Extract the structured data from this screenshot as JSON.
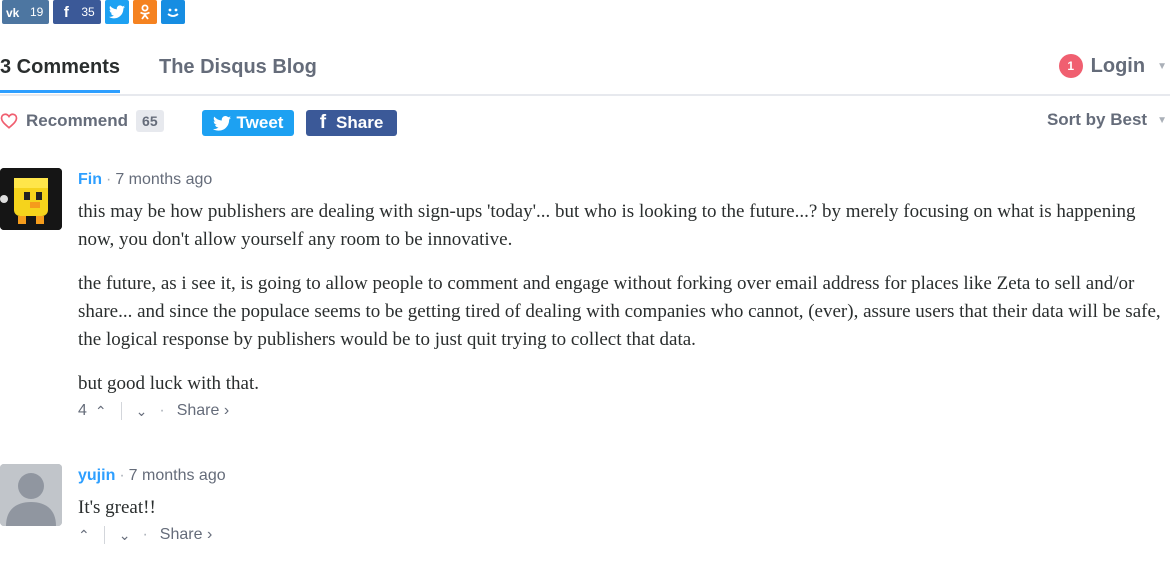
{
  "share_bar": {
    "vk": {
      "icon": "vk-icon",
      "count": "19"
    },
    "facebook": {
      "icon": "facebook-icon",
      "count": "35"
    },
    "twitter": {
      "icon": "twitter-icon"
    },
    "odnoklassniki": {
      "icon": "odnoklassniki-icon"
    },
    "moimir": {
      "icon": "moimir-icon"
    }
  },
  "nav": {
    "comments_tab": "3 Comments",
    "blog_tab": "The Disqus Blog",
    "notifications_count": "1",
    "login_label": "Login"
  },
  "actions": {
    "recommend_label": "Recommend",
    "recommend_count": "65",
    "tweet_label": "Tweet",
    "share_label": "Share",
    "sort_label": "Sort by Best"
  },
  "comments": [
    {
      "author": "Fin",
      "time": "7 months ago",
      "paragraphs": [
        "this may be how publishers are dealing with sign-ups 'today'... but who is looking to the future...? by merely focusing on what is happening now, you don't allow yourself any room to be innovative.",
        "the future, as i see it, is going to allow people to comment and engage without forking over email address for places like Zeta to sell and/or share... and since the populace seems to be getting tired of dealing with companies who cannot, (ever), assure users that their data will be safe, the logical response by publishers would be to just quit trying to collect that data.",
        "but good luck with that."
      ],
      "votes": "4",
      "share_label": "Share ›"
    },
    {
      "author": "yujin",
      "time": "7 months ago",
      "paragraphs": [
        "It's great!!"
      ],
      "votes": "",
      "share_label": "Share ›"
    }
  ],
  "colors": {
    "accent_blue": "#2e9fff",
    "twitter_blue": "#1da1f2",
    "facebook_blue": "#3b5998",
    "badge_red": "#f05f70",
    "muted_text": "#656c7a"
  }
}
